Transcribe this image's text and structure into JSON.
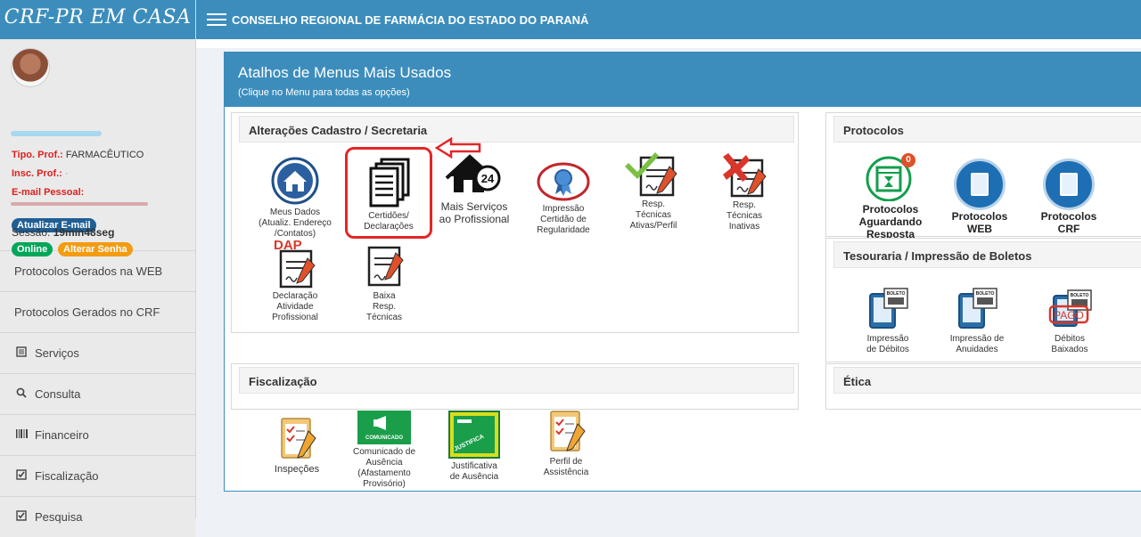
{
  "sidebar": {
    "brand": "CRF-PR EM CASA",
    "profile": {
      "tipo_label": "Tipo. Prof.:",
      "tipo_value": "FARMACÊUTICO",
      "insc_label": "Insc. Prof.:",
      "email_label": "E-mail Pessoal:"
    },
    "buttons": {
      "update_email": "Atualizar E-mail",
      "online": "Online",
      "change_password": "Alterar Senha"
    },
    "session_label": "Sessão:",
    "session_value": "19min48seg",
    "menu": [
      {
        "label": "Protocolos Gerados na WEB",
        "icon": ""
      },
      {
        "label": "Protocolos Gerados no CRF",
        "icon": ""
      },
      {
        "label": "Serviços",
        "icon": "list-icon"
      },
      {
        "label": "Consulta",
        "icon": "search-icon"
      },
      {
        "label": "Financeiro",
        "icon": "barcode-icon"
      },
      {
        "label": "Fiscalização",
        "icon": "checkbox-icon"
      },
      {
        "label": "Pesquisa",
        "icon": "checkbox-icon"
      }
    ]
  },
  "topbar": {
    "title": "CONSELHO REGIONAL DE FARMÁCIA DO ESTADO DO PARANÁ"
  },
  "main": {
    "title": "Atalhos de Menus Mais Usados",
    "subtitle": "(Clique no Menu para todas as opções)",
    "sections": {
      "cadastro": {
        "title": "Alterações Cadastro / Secretaria",
        "tiles": [
          {
            "l1": "Meus Dados",
            "l2": "(Atualiz. Endereço",
            "l3": "/Contatos)"
          },
          {
            "l1": "Certidões/",
            "l2": "Declarações"
          },
          {
            "l1": "Mais Serviços",
            "l2": "ao Profissional",
            "badge": "24"
          },
          {
            "l1": "Impressão",
            "l2": "Certidão de",
            "l3": "Regularidade"
          },
          {
            "l1": "Resp.",
            "l2": "Técnicas",
            "l3": "Ativas/Perfil"
          },
          {
            "l1": "Resp.",
            "l2": "Técnicas",
            "l3": "Inativas"
          },
          {
            "l1": "Declaração",
            "l2": "Atividade",
            "l3": "Profissional",
            "tag": "DAP"
          },
          {
            "l1": "Baixa",
            "l2": "Resp.",
            "l3": "Técnicas"
          }
        ]
      },
      "protocolos": {
        "title": "Protocolos",
        "tiles": [
          {
            "l1": "Protocolos",
            "l2": "Aguardando",
            "l3": "Resposta",
            "badge": "0"
          },
          {
            "l1": "Protocolos",
            "l2": "WEB"
          },
          {
            "l1": "Protocolos",
            "l2": "CRF"
          }
        ]
      },
      "tesouraria": {
        "title": "Tesouraria / Impressão de Boletos",
        "tiles": [
          {
            "l1": "Impressão",
            "l2": "de Débitos",
            "tag": "BOLETO"
          },
          {
            "l1": "Impressão de",
            "l2": "Anuidades",
            "tag": "BOLETO"
          },
          {
            "l1": "Débitos",
            "l2": "Baixados",
            "tag": "BOLETO",
            "stamp": "PAGO"
          }
        ]
      },
      "fiscalizacao": {
        "title": "Fiscalização",
        "tiles": [
          {
            "l1": "Inspeções"
          },
          {
            "l1": "Comunicado de",
            "l2": "Ausência",
            "l3": "(Afastamento",
            "l4": "Provisório)",
            "tag": "COMUNICADO"
          },
          {
            "l1": "Justificativa",
            "l2": "de Ausência",
            "tag": "JUSTIFICA"
          },
          {
            "l1": "Perfil de",
            "l2": "Assistência"
          }
        ]
      },
      "etica": {
        "title": "Ética"
      }
    }
  },
  "colors": {
    "primary": "#3c8dbc",
    "red": "#dd1f1f",
    "green": "#00a65a",
    "orange": "#f39c12",
    "navy": "#1e6eb4"
  }
}
